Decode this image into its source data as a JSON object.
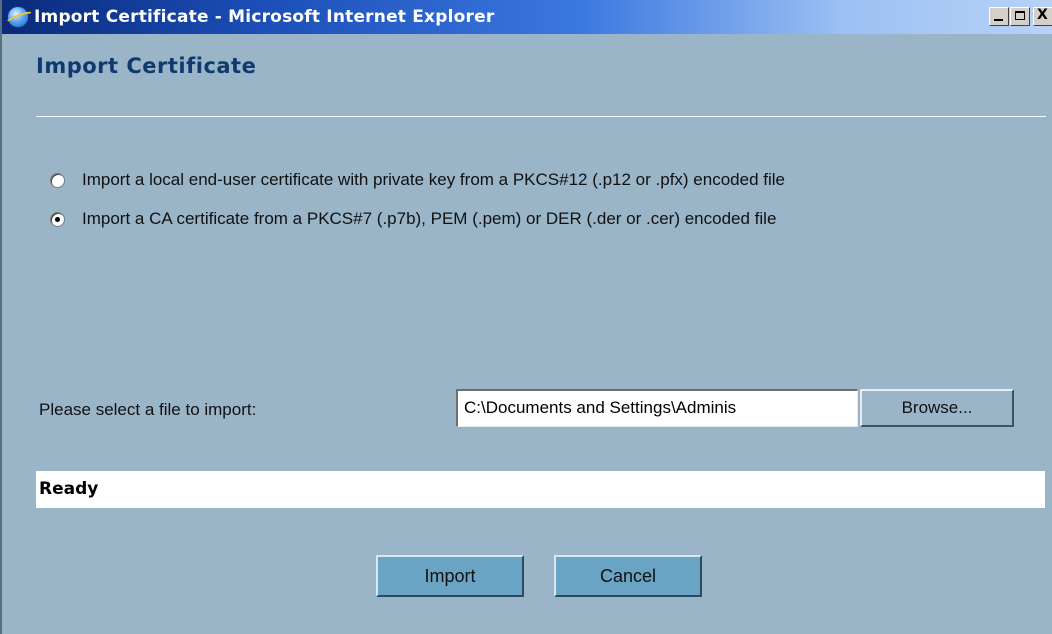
{
  "window": {
    "title": "Import Certificate - Microsoft Internet Explorer",
    "icon": "internet-explorer-icon",
    "controls": {
      "minimize": "minimize-icon",
      "maximize": "maximize-icon",
      "close_glyph": "X"
    }
  },
  "page": {
    "heading": "Import Certificate",
    "options": [
      {
        "label": "Import a local end-user certificate with private key from a PKCS#12 (.p12 or .pfx) encoded file",
        "selected": false
      },
      {
        "label": "Import a CA certificate from a PKCS#7 (.p7b), PEM (.pem) or DER (.der or .cer) encoded file",
        "selected": true
      }
    ],
    "file_prompt": "Please select a file to import:",
    "file_path": "C:\\Documents and Settings\\Adminis",
    "browse_label": "Browse...",
    "status": "Ready",
    "import_label": "Import",
    "cancel_label": "Cancel"
  },
  "colors": {
    "background": "#9ab4c8",
    "heading": "#0f3a6e",
    "action_button": "#6aa4c4"
  }
}
